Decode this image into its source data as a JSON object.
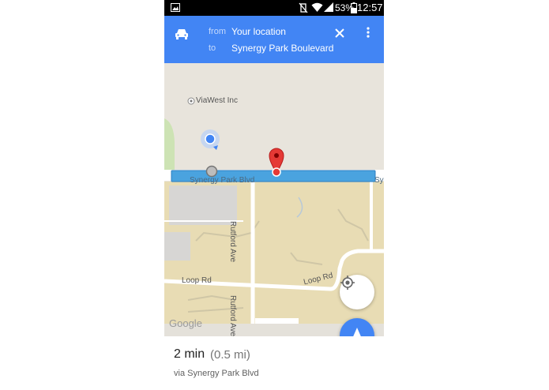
{
  "status_bar": {
    "battery_percent": "53%",
    "time": "12:57",
    "icons": [
      "image-notification-icon",
      "vibrate-icon",
      "wifi-icon",
      "signal-icon",
      "battery-icon"
    ]
  },
  "directions_bar": {
    "mode_icon": "car-icon",
    "from_label": "from",
    "from_value": "Your location",
    "to_label": "to",
    "to_value": "Synergy Park Boulevard",
    "close_icon": "close-icon",
    "menu_icon": "more-vert-icon"
  },
  "map": {
    "labels": {
      "poi": "ViaWest Inc",
      "main_road": "Synergy Park Blvd",
      "main_road_cut": "Sy",
      "rutford_upper": "Rutford Ave",
      "rutford_lower": "Rutford Ave",
      "loop_left": "Loop Rd",
      "loop_right": "Loop Rd",
      "attribution": "Google"
    },
    "route_color": "#4aa3df",
    "my_location_icon": "my-location-icon",
    "navigate_icon": "navigation-arrow-icon"
  },
  "summary": {
    "duration": "2 min",
    "distance": "(0.5 mi)",
    "via": "via Synergy Park Blvd"
  }
}
